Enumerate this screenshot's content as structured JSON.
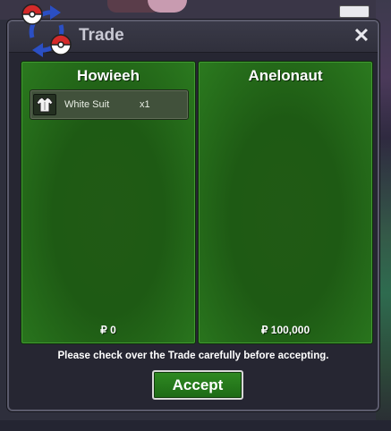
{
  "window": {
    "title": "Trade",
    "close_label": "✕"
  },
  "left_trader": {
    "name": "Howieeh",
    "money": "₽ 0",
    "items": [
      {
        "name": "White Suit",
        "qty": "x1",
        "icon": "shirt-icon"
      }
    ]
  },
  "right_trader": {
    "name": "Anelonaut",
    "money": "₽ 100,000",
    "items": []
  },
  "footer": {
    "notice": "Please check over the Trade carefully before accepting.",
    "accept_label": "Accept"
  },
  "colors": {
    "panel_green": "#215a15",
    "accept_green": "#2f8a22",
    "window_bg": "#262632"
  }
}
